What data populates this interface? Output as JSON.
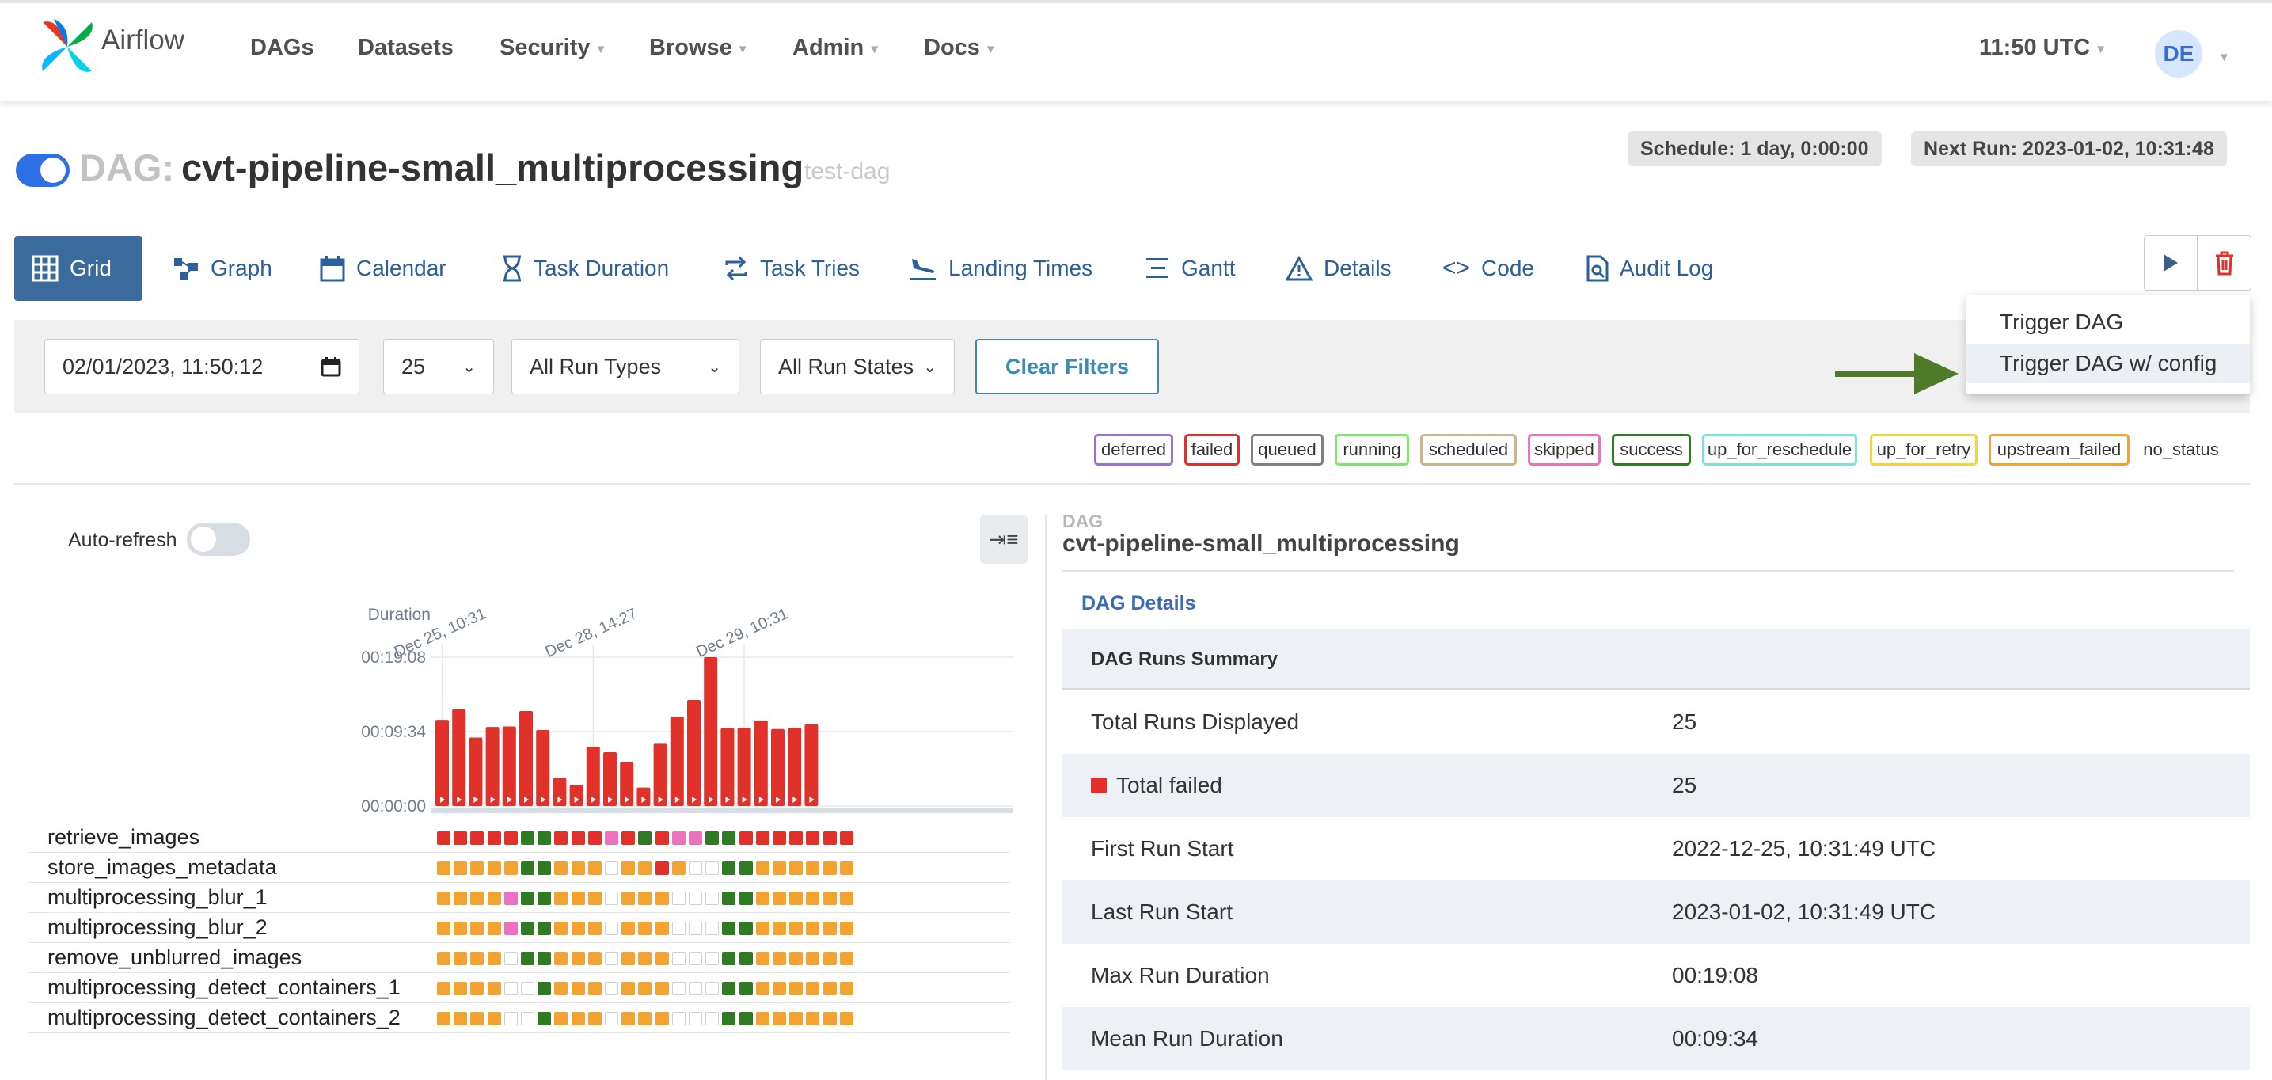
{
  "navbar": {
    "brand": "Airflow",
    "items": [
      {
        "label": "DAGs",
        "dropdown": false
      },
      {
        "label": "Datasets",
        "dropdown": false
      },
      {
        "label": "Security",
        "dropdown": true
      },
      {
        "label": "Browse",
        "dropdown": true
      },
      {
        "label": "Admin",
        "dropdown": true
      },
      {
        "label": "Docs",
        "dropdown": true
      }
    ],
    "clock": "11:50 UTC",
    "avatar": "DE"
  },
  "header": {
    "prefix": "DAG:",
    "dag_id": "cvt-pipeline-small_multiprocessing",
    "tag": "test-dag",
    "schedule": "Schedule: 1 day, 0:00:00",
    "next_run": "Next Run: 2023-01-02, 10:31:48",
    "paused": false
  },
  "tabs": [
    {
      "label": "Grid",
      "icon": "grid-icon",
      "active": true
    },
    {
      "label": "Graph",
      "icon": "graph-icon"
    },
    {
      "label": "Calendar",
      "icon": "calendar-icon"
    },
    {
      "label": "Task Duration",
      "icon": "hourglass-icon"
    },
    {
      "label": "Task Tries",
      "icon": "retry-icon"
    },
    {
      "label": "Landing Times",
      "icon": "plane-landing-icon"
    },
    {
      "label": "Gantt",
      "icon": "gantt-icon"
    },
    {
      "label": "Details",
      "icon": "warning-triangle-icon"
    },
    {
      "label": "Code",
      "icon": "code-icon"
    },
    {
      "label": "Audit Log",
      "icon": "audit-log-icon"
    }
  ],
  "filters": {
    "base_date": "02/01/2023, 11:50:12",
    "num_runs": "25",
    "run_type": "All Run Types",
    "run_state": "All Run States",
    "clear_label": "Clear Filters"
  },
  "trigger_menu": {
    "items": [
      "Trigger DAG",
      "Trigger DAG w/ config"
    ],
    "highlighted": 1
  },
  "legend": [
    {
      "label": "deferred",
      "color": "#9b6ed8"
    },
    {
      "label": "failed",
      "color": "#e0322b"
    },
    {
      "label": "queued",
      "color": "#808080"
    },
    {
      "label": "running",
      "color": "#7ce86b"
    },
    {
      "label": "scheduled",
      "color": "#d2b48c"
    },
    {
      "label": "skipped",
      "color": "#ec72c0"
    },
    {
      "label": "success",
      "color": "#2f7a22"
    },
    {
      "label": "up_for_reschedule",
      "color": "#7ee0de"
    },
    {
      "label": "up_for_retry",
      "color": "#f5d33e"
    },
    {
      "label": "upstream_failed",
      "color": "#f2a332"
    },
    {
      "label": "no_status",
      "color": ""
    }
  ],
  "grid": {
    "auto_refresh_label": "Auto-refresh",
    "auto_refresh": false,
    "tasks": [
      {
        "name": "retrieve_images",
        "states": "FFFFFSSFFFKFSFKKSSFFFFFFF"
      },
      {
        "name": "store_images_metadata",
        "states": "UUUUUSSUUUNUUFUNNSSUUUUUU"
      },
      {
        "name": "multiprocessing_blur_1",
        "states": "UUUUKSSUUUNUUUNNNSSUUUUUU"
      },
      {
        "name": "multiprocessing_blur_2",
        "states": "UUUUKSSUUUNUUUNNNSSUUUUUU"
      },
      {
        "name": "remove_unblurred_images",
        "states": "UUUUNSSUUUNUUUNNNSSUUUUUU"
      },
      {
        "name": "multiprocessing_detect_containers_1",
        "states": "UUUUNNSUUUNUUUNNNSSUUUUUU"
      },
      {
        "name": "multiprocessing_detect_containers_2",
        "states": "UUUUNNSUUUNUUUNNNSSUUUUUU"
      }
    ],
    "state_colors": {
      "F": "#e0322b",
      "S": "#2f7a22",
      "U": "#f2a332",
      "K": "#ec72c0",
      "N": "#ffffff"
    }
  },
  "chart_data": {
    "type": "bar",
    "ylabel": "Duration",
    "yticks": [
      "00:00:00",
      "00:09:34",
      "00:19:08"
    ],
    "ymax_seconds": 1148,
    "xlabels": [
      {
        "index": 0,
        "label": "Dec 25, 10:31"
      },
      {
        "index": 9,
        "label": "Dec 28, 14:27"
      },
      {
        "index": 18,
        "label": "Dec 29, 10:31"
      }
    ],
    "values_seconds": [
      665,
      748,
      528,
      610,
      614,
      733,
      586,
      217,
      163,
      458,
      415,
      340,
      143,
      480,
      690,
      818,
      1148,
      600,
      603,
      660,
      594,
      604,
      630
    ],
    "color": "#e0322b"
  },
  "details": {
    "small": "DAG",
    "title": "cvt-pipeline-small_multiprocessing",
    "link": "DAG Details",
    "summary_header": "DAG Runs Summary",
    "rows": [
      {
        "key": "Total Runs Displayed",
        "value": "25"
      },
      {
        "key": "Total failed",
        "value": "25",
        "swatch": "#e0322b"
      },
      {
        "key": "First Run Start",
        "value": "2022-12-25, 10:31:49 UTC"
      },
      {
        "key": "Last Run Start",
        "value": "2023-01-02, 10:31:49 UTC"
      },
      {
        "key": "Max Run Duration",
        "value": "00:19:08"
      },
      {
        "key": "Mean Run Duration",
        "value": "00:09:34"
      }
    ]
  }
}
